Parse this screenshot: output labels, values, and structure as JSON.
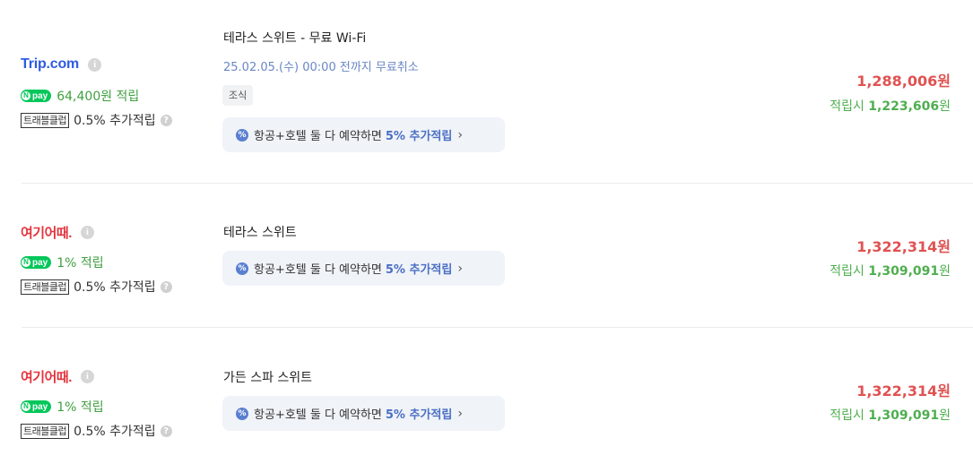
{
  "offers": [
    {
      "provider": "Trip.com",
      "npay_text": "64,400원 적립",
      "npay_label": "pay",
      "club_badge": "트래블클럽",
      "club_text": "0.5% 추가적립",
      "room_name": "테라스 스위트 - 무료 Wi-Fi",
      "cancel_text": "25.02.05.(수) 00:00 전까지 무료취소",
      "meal_tag": "조식",
      "promo_text": "항공+호텔 둘 다 예약하면",
      "promo_highlight": "5% 추가적립",
      "price": "1,288,006원",
      "earn_prefix": "적립시",
      "earn_price": "1,223,606",
      "earn_suffix": "원"
    },
    {
      "provider": "여기어때.",
      "npay_text": "1% 적립",
      "npay_label": "pay",
      "club_badge": "트래블클럽",
      "club_text": "0.5% 추가적립",
      "room_name": "테라스 스위트",
      "promo_text": "항공+호텔 둘 다 예약하면",
      "promo_highlight": "5% 추가적립",
      "price": "1,322,314원",
      "earn_prefix": "적립시",
      "earn_price": "1,309,091",
      "earn_suffix": "원"
    },
    {
      "provider": "여기어때.",
      "npay_text": "1% 적립",
      "npay_label": "pay",
      "club_badge": "트래블클럽",
      "club_text": "0.5% 추가적립",
      "room_name": "가든 스파 스위트",
      "promo_text": "항공+호텔 둘 다 예약하면",
      "promo_highlight": "5% 추가적립",
      "price": "1,322,314원",
      "earn_prefix": "적립시",
      "earn_price": "1,309,091",
      "earn_suffix": "원"
    }
  ],
  "icons": {
    "info": "info-icon",
    "help": "question-icon",
    "promo": "percent-badge-icon",
    "chevron": "chevron-right-icon"
  },
  "colors": {
    "price": "#e05252",
    "earn": "#4fae4f",
    "npay": "#03c75a",
    "trip_brand": "#2e5be3",
    "yeogi_brand": "#e5343c",
    "promo_accent": "#4a6fc4"
  }
}
